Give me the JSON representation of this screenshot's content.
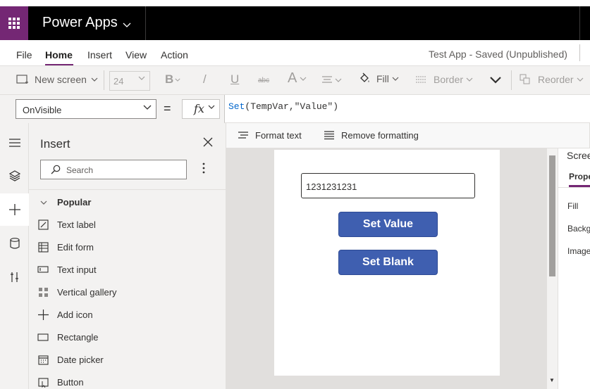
{
  "app": {
    "name": "Power Apps",
    "status": "Test App - Saved (Unpublished)"
  },
  "menu": {
    "items": [
      "File",
      "Home",
      "Insert",
      "View",
      "Action"
    ],
    "active": "Home"
  },
  "toolbar": {
    "new_screen": "New screen",
    "font_size": "24",
    "bold": "B",
    "italic": "/",
    "underline": "U",
    "strike": "abc",
    "font": "A",
    "fill": "Fill",
    "border": "Border",
    "reorder": "Reorder"
  },
  "formula": {
    "property": "OnVisible",
    "equals": "=",
    "fx": "fx",
    "fn": "Set",
    "args": "(TempVar,\"Value\")"
  },
  "format_bar": {
    "format_text": "Format text",
    "remove_formatting": "Remove formatting"
  },
  "insert_panel": {
    "title": "Insert",
    "search_placeholder": "Search",
    "section": "Popular",
    "items": [
      {
        "label": "Text label",
        "icon": "text-label-icon"
      },
      {
        "label": "Edit form",
        "icon": "edit-form-icon"
      },
      {
        "label": "Text input",
        "icon": "text-input-icon"
      },
      {
        "label": "Vertical gallery",
        "icon": "vertical-gallery-icon"
      },
      {
        "label": "Add icon",
        "icon": "add-icon"
      },
      {
        "label": "Rectangle",
        "icon": "rectangle-icon"
      },
      {
        "label": "Date picker",
        "icon": "date-picker-icon"
      },
      {
        "label": "Button",
        "icon": "button-icon"
      }
    ]
  },
  "canvas": {
    "text_input_value": "1231231231",
    "buttons": [
      "Set Value",
      "Set Blank"
    ]
  },
  "properties": {
    "title": "Scree",
    "tab": "Prope",
    "labels": [
      "Fill",
      "Backgr",
      "Image"
    ]
  },
  "colors": {
    "brand": "#742774",
    "button": "#3f5fb0",
    "topbar": "#000000"
  }
}
